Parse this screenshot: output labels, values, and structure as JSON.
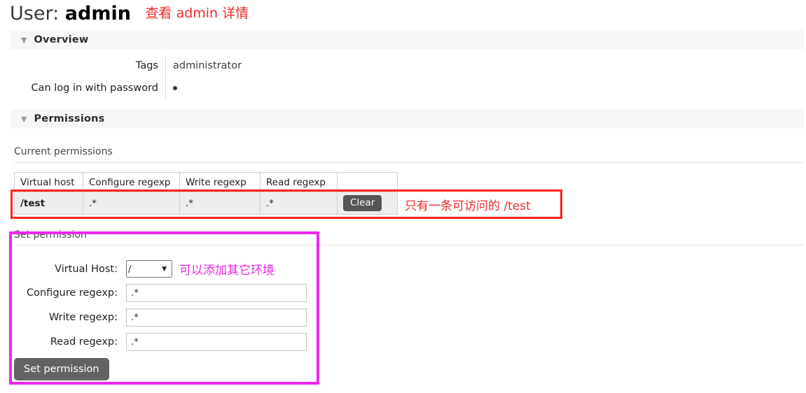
{
  "page": {
    "title_prefix": "User:",
    "user_name": "admin",
    "title_annotation": "查看 admin 详情"
  },
  "sections": {
    "overview": {
      "caret": "▼",
      "title": "Overview",
      "rows": [
        {
          "key": "Tags",
          "value": "administrator",
          "is_bullet": false
        },
        {
          "key": "Can log in with password",
          "value": "",
          "is_bullet": true
        }
      ]
    },
    "permissions": {
      "caret": "▼",
      "title": "Permissions",
      "current_label": "Current permissions",
      "table": {
        "headers": [
          "Virtual host",
          "Configure regexp",
          "Write regexp",
          "Read regexp",
          ""
        ],
        "rows": [
          {
            "virtual_host": "/test",
            "configure_regexp": ".*",
            "write_regexp": ".*",
            "read_regexp": ".*",
            "action_label": "Clear"
          }
        ]
      },
      "row_annotation": "只有一条可访问的 /test",
      "set_permission": {
        "legend": "Set permission",
        "vhost_label": "Virtual Host:",
        "vhost_value": "/",
        "vhost_options": [
          "/"
        ],
        "vhost_annotation": "可以添加其它环境",
        "configure_label": "Configure regexp:",
        "configure_value": ".*",
        "write_label": "Write regexp:",
        "write_value": ".*",
        "read_label": "Read regexp:",
        "read_value": ".*",
        "submit_label": "Set permission"
      }
    }
  },
  "colors": {
    "red_annotation": "#ee2b2b",
    "magenta_annotation": "#ef27ef",
    "section_bar_bg": "#f7f7f7",
    "button_gray": "#636363",
    "clear_button_gray": "#555555"
  }
}
